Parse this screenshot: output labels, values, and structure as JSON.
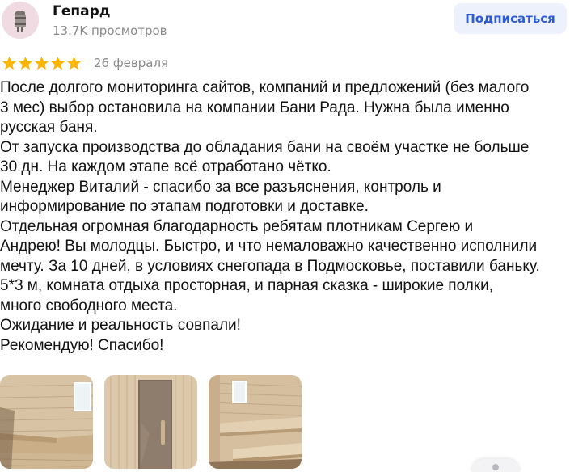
{
  "author": {
    "name": "Гепард",
    "views": "13.7K просмотров",
    "avatar_icon": "sauna-bucket-icon"
  },
  "actions": {
    "subscribe_label": "Подписаться"
  },
  "rating": {
    "stars": 5,
    "max_stars": 5,
    "star_color": "#fcb600",
    "date": "26 февраля"
  },
  "review": {
    "lines": [
      "После долгого мониторинга сайтов, компаний и предложений (без малого",
      "3 мес) выбор остановила на компании Бани Рада. Нужна была именно",
      "русская баня.",
      "От запуска производства до обладания бани на своём участке не больше",
      "30 дн. На каждом этапе всё отработано чётко.",
      "Менеджер Виталий - спасибо за все разъяснения, контроль и",
      "информирование по этапам подготовки и доставке.",
      "Отдельная огромная благодарность ребятам плотникам Сергею и",
      "Андрею! Вы молодцы. Быстро, и что немаловажно качественно исполнили",
      "мечту. За 10 дней, в условиях снегопада в Подмосковье, поставили баньку.",
      "5*3 м, комната отдыха просторная, и парная сказка - широкие полки,",
      "много свободного места.",
      "Ожидание и реальность совпали!",
      "Рекомендую! Спасибо!"
    ]
  },
  "photos": [
    {
      "subject": "sauna-interior-window-photo"
    },
    {
      "subject": "sauna-glass-door-photo"
    },
    {
      "subject": "sauna-steam-room-benches-photo"
    }
  ],
  "colors": {
    "accent": "#2b5bd7",
    "button_bg": "#edf1fb",
    "muted_text": "#8a8a8a",
    "wood": "#d9c2a2"
  }
}
